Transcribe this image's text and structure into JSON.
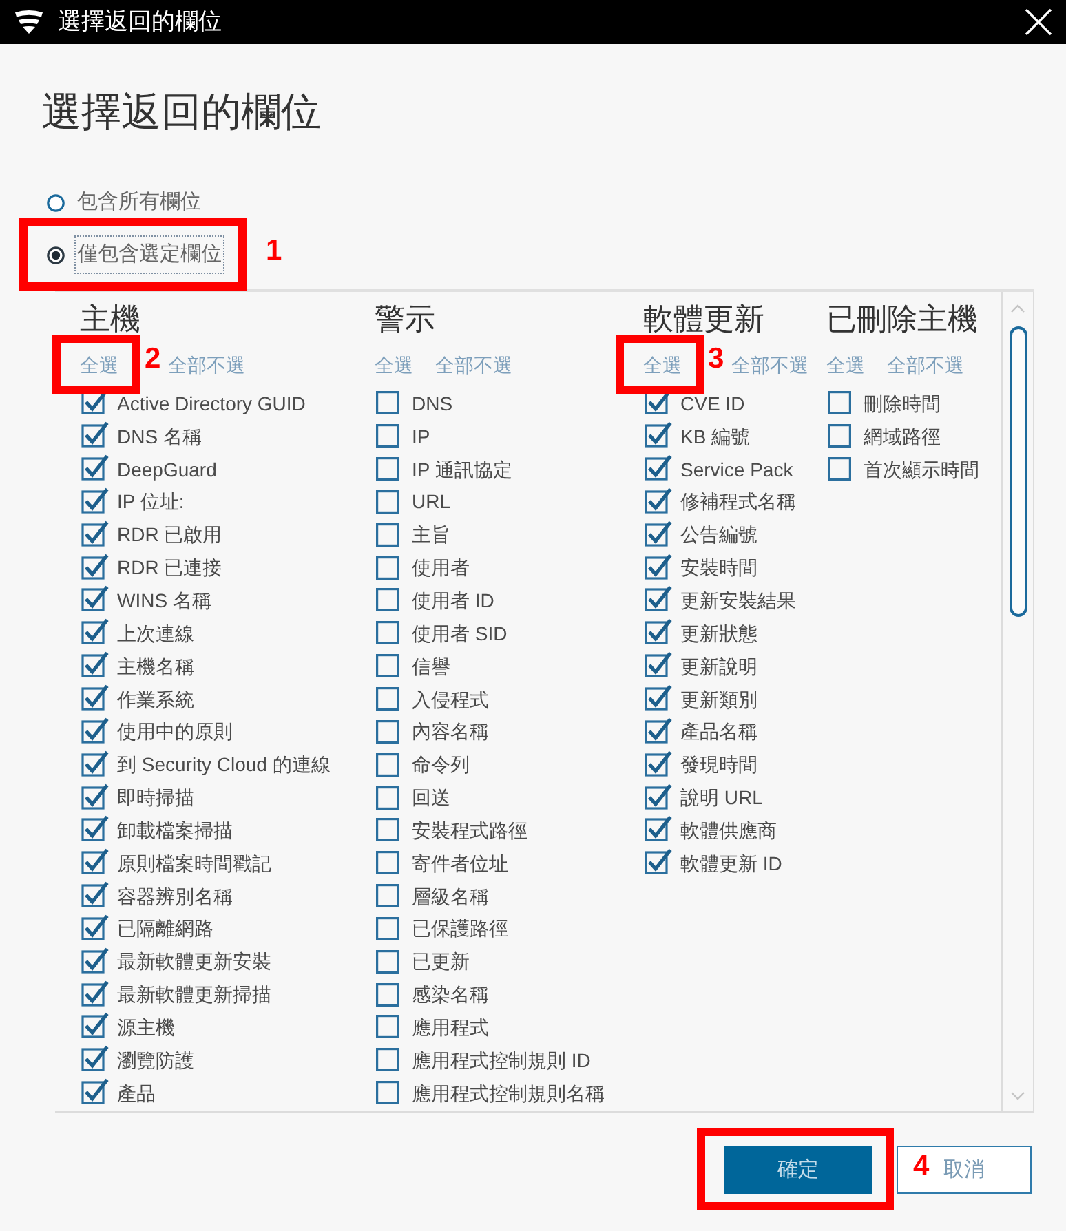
{
  "window": {
    "title": "選擇返回的欄位"
  },
  "heading": "選擇返回的欄位",
  "scope_options": [
    {
      "label": "包含所有欄位",
      "selected": false,
      "focused": false
    },
    {
      "label": "僅包含選定欄位",
      "selected": true,
      "focused": true,
      "callout": "1"
    }
  ],
  "columns": [
    {
      "title": "主機",
      "select_all": {
        "label": "全選",
        "callout": "2"
      },
      "select_none": {
        "label": "全部不選"
      },
      "fields": [
        {
          "label": "Active Directory GUID",
          "checked": true
        },
        {
          "label": "DNS 名稱",
          "checked": true
        },
        {
          "label": "DeepGuard",
          "checked": true
        },
        {
          "label": "IP 位址:",
          "checked": true
        },
        {
          "label": "RDR 已啟用",
          "checked": true
        },
        {
          "label": "RDR 已連接",
          "checked": true
        },
        {
          "label": "WINS 名稱",
          "checked": true
        },
        {
          "label": "上次連線",
          "checked": true
        },
        {
          "label": "主機名稱",
          "checked": true
        },
        {
          "label": "作業系統",
          "checked": true
        },
        {
          "label": "使用中的原則",
          "checked": true
        },
        {
          "label": "到 Security Cloud 的連線",
          "checked": true
        },
        {
          "label": "即時掃描",
          "checked": true
        },
        {
          "label": "卸載檔案掃描",
          "checked": true
        },
        {
          "label": "原則檔案時間戳記",
          "checked": true
        },
        {
          "label": "容器辨別名稱",
          "checked": true
        },
        {
          "label": "已隔離網路",
          "checked": true
        },
        {
          "label": "最新軟體更新安裝",
          "checked": true
        },
        {
          "label": "最新軟體更新掃描",
          "checked": true
        },
        {
          "label": "源主機",
          "checked": true
        },
        {
          "label": "瀏覽防護",
          "checked": true
        },
        {
          "label": "產品",
          "checked": true
        }
      ]
    },
    {
      "title": "警示",
      "select_all": {
        "label": "全選"
      },
      "select_none": {
        "label": "全部不選"
      },
      "fields": [
        {
          "label": "DNS",
          "checked": false
        },
        {
          "label": "IP",
          "checked": false
        },
        {
          "label": "IP 通訊協定",
          "checked": false
        },
        {
          "label": "URL",
          "checked": false
        },
        {
          "label": "主旨",
          "checked": false
        },
        {
          "label": "使用者",
          "checked": false
        },
        {
          "label": "使用者 ID",
          "checked": false
        },
        {
          "label": "使用者 SID",
          "checked": false
        },
        {
          "label": "信譽",
          "checked": false
        },
        {
          "label": "入侵程式",
          "checked": false
        },
        {
          "label": "內容名稱",
          "checked": false
        },
        {
          "label": "命令列",
          "checked": false
        },
        {
          "label": "回送",
          "checked": false
        },
        {
          "label": "安裝程式路徑",
          "checked": false
        },
        {
          "label": "寄件者位址",
          "checked": false
        },
        {
          "label": "層級名稱",
          "checked": false
        },
        {
          "label": "已保護路徑",
          "checked": false
        },
        {
          "label": "已更新",
          "checked": false
        },
        {
          "label": "感染名稱",
          "checked": false
        },
        {
          "label": "應用程式",
          "checked": false
        },
        {
          "label": "應用程式控制規則 ID",
          "checked": false
        },
        {
          "label": "應用程式控制規則名稱",
          "checked": false
        }
      ]
    },
    {
      "title": "軟體更新",
      "select_all": {
        "label": "全選",
        "callout": "3"
      },
      "select_none": {
        "label": "全部不選"
      },
      "fields": [
        {
          "label": "CVE ID",
          "checked": true
        },
        {
          "label": "KB 編號",
          "checked": true
        },
        {
          "label": "Service Pack",
          "checked": true
        },
        {
          "label": "修補程式名稱",
          "checked": true
        },
        {
          "label": "公告編號",
          "checked": true
        },
        {
          "label": "安裝時間",
          "checked": true
        },
        {
          "label": "更新安裝結果",
          "checked": true
        },
        {
          "label": "更新狀態",
          "checked": true
        },
        {
          "label": "更新說明",
          "checked": true
        },
        {
          "label": "更新類別",
          "checked": true
        },
        {
          "label": "產品名稱",
          "checked": true
        },
        {
          "label": "發現時間",
          "checked": true
        },
        {
          "label": "說明 URL",
          "checked": true
        },
        {
          "label": "軟體供應商",
          "checked": true
        },
        {
          "label": "軟體更新 ID",
          "checked": true
        }
      ]
    },
    {
      "title": "已刪除主機",
      "select_all": {
        "label": "全選"
      },
      "select_none": {
        "label": "全部不選"
      },
      "fields": [
        {
          "label": "刪除時間",
          "checked": false
        },
        {
          "label": "網域路徑",
          "checked": false
        },
        {
          "label": "首次顯示時間",
          "checked": false
        }
      ]
    }
  ],
  "buttons": [
    {
      "label": "確定",
      "kind": "primary",
      "callout": "4"
    },
    {
      "label": "取消",
      "kind": "secondary"
    }
  ]
}
